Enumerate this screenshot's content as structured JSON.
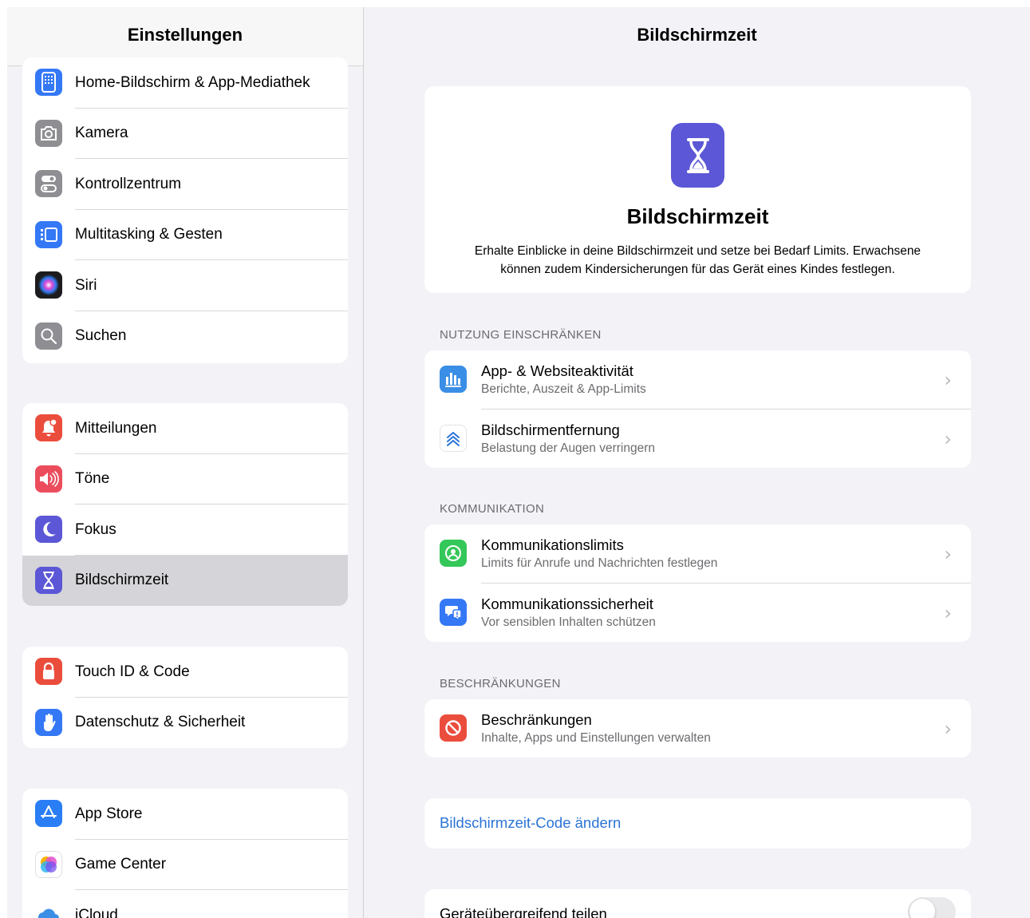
{
  "sidebar": {
    "title": "Einstellungen",
    "groups": [
      {
        "items": [
          {
            "label": "Home-Bildschirm & App-Mediathek",
            "icon": "home-screen-icon",
            "color": "#3478f6"
          },
          {
            "label": "Kamera",
            "icon": "camera-icon",
            "color": "#8e8e93"
          },
          {
            "label": "Kontrollzentrum",
            "icon": "control-center-icon",
            "color": "#8e8e93"
          },
          {
            "label": "Multitasking & Gesten",
            "icon": "multitasking-icon",
            "color": "#3478f6"
          },
          {
            "label": "Siri",
            "icon": "siri-icon",
            "color": "#1c1c1e"
          },
          {
            "label": "Suchen",
            "icon": "search-icon",
            "color": "#8e8e93"
          }
        ]
      },
      {
        "items": [
          {
            "label": "Mitteilungen",
            "icon": "notifications-icon",
            "color": "#eb4d3d"
          },
          {
            "label": "Töne",
            "icon": "sounds-icon",
            "color": "#eb4d5d"
          },
          {
            "label": "Fokus",
            "icon": "focus-moon-icon",
            "color": "#5b57d6"
          },
          {
            "label": "Bildschirmzeit",
            "icon": "hourglass-icon",
            "color": "#5b57d6",
            "selected": true
          }
        ]
      },
      {
        "items": [
          {
            "label": "Touch ID & Code",
            "icon": "lock-icon",
            "color": "#eb4d3d"
          },
          {
            "label": "Datenschutz & Sicherheit",
            "icon": "hand-icon",
            "color": "#3478f6"
          }
        ]
      },
      {
        "items": [
          {
            "label": "App Store",
            "icon": "app-store-icon",
            "color": "#2a7ef5"
          },
          {
            "label": "Game Center",
            "icon": "game-center-icon",
            "color": "#ffffff"
          },
          {
            "label": "iCloud",
            "icon": "icloud-icon",
            "color": "#ffffff"
          }
        ]
      }
    ]
  },
  "detail": {
    "title": "Bildschirmzeit",
    "hero": {
      "title": "Bildschirmzeit",
      "description": "Erhalte Einblicke in deine Bildschirmzeit und setze bei Bedarf Limits. Erwachsene können zudem Kindersicherungen für das Gerät eines Kindes festlegen.",
      "icon": "hourglass-icon",
      "color": "#5b57d6"
    },
    "sections": [
      {
        "header": "NUTZUNG EINSCHRÄNKEN",
        "rows": [
          {
            "title": "App- & Websiteaktivität",
            "subtitle": "Berichte, Auszeit & App-Limits",
            "icon": "activity-chart-icon",
            "color": "#3a8ee6"
          },
          {
            "title": "Bildschirmentfernung",
            "subtitle": "Belastung der Augen verringern",
            "icon": "screen-distance-icon",
            "color": "#ffffff"
          }
        ]
      },
      {
        "header": "KOMMUNIKATION",
        "rows": [
          {
            "title": "Kommunikationslimits",
            "subtitle": "Limits für Anrufe und Nachrichten festlegen",
            "icon": "communication-limits-icon",
            "color": "#34c759"
          },
          {
            "title": "Kommunikationssicherheit",
            "subtitle": "Vor sensiblen Inhalten schützen",
            "icon": "communication-safety-icon",
            "color": "#3478f6"
          }
        ]
      },
      {
        "header": "BESCHRÄNKUNGEN",
        "rows": [
          {
            "title": "Beschränkungen",
            "subtitle": "Inhalte, Apps und Einstellungen verwalten",
            "icon": "restrictions-icon",
            "color": "#eb4d3d"
          }
        ]
      }
    ],
    "code_link": "Bildschirmzeit-Code ändern",
    "share": {
      "label": "Geräteübergreifend teilen",
      "enabled": false
    },
    "chevron": "›"
  }
}
